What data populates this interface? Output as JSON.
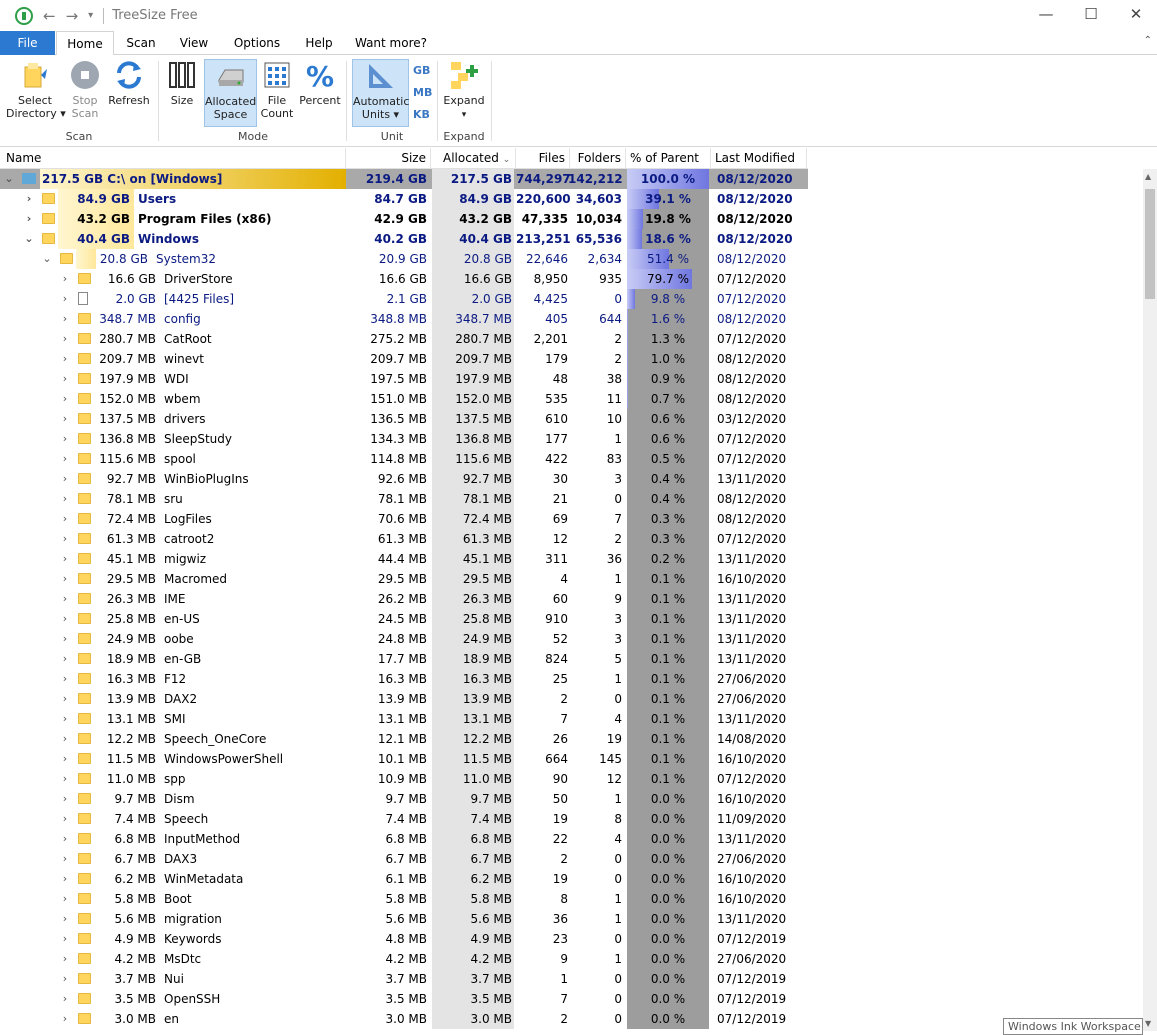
{
  "app": {
    "title": "TreeSize Free",
    "quick_access": [
      "←",
      "→",
      "▾"
    ]
  },
  "window_controls": {
    "minimize": "—",
    "maximize": "☐",
    "close": "✕"
  },
  "tabs": [
    {
      "label": "File"
    },
    {
      "label": "Home"
    },
    {
      "label": "Scan"
    },
    {
      "label": "View"
    },
    {
      "label": "Options"
    },
    {
      "label": "Help"
    },
    {
      "label": "Want more?"
    }
  ],
  "ribbon": {
    "select_directory": "Select\nDirectory ▾",
    "stop_scan": "Stop\nScan",
    "refresh": "Refresh",
    "size": "Size",
    "allocated_space": "Allocated\nSpace",
    "file_count": "File\nCount",
    "percent": "Percent",
    "automatic_units": "Automatic\nUnits ▾",
    "unit_gb": "GB",
    "unit_mb": "MB",
    "unit_kb": "KB",
    "expand": "Expand",
    "groups": {
      "scan": "Scan",
      "mode": "Mode",
      "unit": "Unit",
      "expand": "Expand"
    }
  },
  "columns": {
    "name": "Name",
    "size": "Size",
    "allocated": "Allocated",
    "files": "Files",
    "folders": "Folders",
    "pct": "% of Parent ...",
    "modified": "Last Modified"
  },
  "rows": [
    {
      "level": 0,
      "label": "217.5 GB  C:\\  on  [Windows]",
      "size": "219.4 GB",
      "alloc": "217.5 GB",
      "files": "744,297",
      "folders": "142,212",
      "pct": "100.0 %",
      "pct_value": 100.0,
      "mod": "08/12/2020",
      "style": "root",
      "exp": "v",
      "icon": "drive"
    },
    {
      "level": 1,
      "sz": "84.9 GB",
      "name": "Users",
      "size": "84.7 GB",
      "alloc": "84.9 GB",
      "files": "220,600",
      "folders": "34,603",
      "pct": "39.1 %",
      "pct_value": 39.1,
      "mod": "08/12/2020",
      "style": "bold-blue",
      "exp": ">"
    },
    {
      "level": 1,
      "sz": "43.2 GB",
      "name": "Program Files (x86)",
      "size": "42.9 GB",
      "alloc": "43.2 GB",
      "files": "47,335",
      "folders": "10,034",
      "pct": "19.8 %",
      "pct_value": 19.8,
      "mod": "08/12/2020",
      "style": "bold",
      "exp": ">"
    },
    {
      "level": 1,
      "sz": "40.4 GB",
      "name": "Windows",
      "size": "40.2 GB",
      "alloc": "40.4 GB",
      "files": "213,251",
      "folders": "65,536",
      "pct": "18.6 %",
      "pct_value": 18.6,
      "mod": "08/12/2020",
      "style": "bold-blue",
      "exp": "v"
    },
    {
      "level": 2,
      "sz": "20.8 GB",
      "name": "System32",
      "size": "20.9 GB",
      "alloc": "20.8 GB",
      "files": "22,646",
      "folders": "2,634",
      "pct": "51.4 %",
      "pct_value": 51.4,
      "mod": "08/12/2020",
      "style": "blue",
      "exp": "v"
    },
    {
      "level": 3,
      "sz": "16.6 GB",
      "name": "DriverStore",
      "size": "16.6 GB",
      "alloc": "16.6 GB",
      "files": "8,950",
      "folders": "935",
      "pct": "79.7 %",
      "pct_value": 79.7,
      "mod": "07/12/2020",
      "style": "",
      "exp": ">"
    },
    {
      "level": 3,
      "sz": "2.0 GB",
      "name": "[4425 Files]",
      "size": "2.1 GB",
      "alloc": "2.0 GB",
      "files": "4,425",
      "folders": "0",
      "pct": "9.8 %",
      "pct_value": 9.8,
      "mod": "07/12/2020",
      "style": "blue",
      "exp": ">",
      "icon": "file"
    },
    {
      "level": 3,
      "sz": "348.7 MB",
      "name": "config",
      "size": "348.8 MB",
      "alloc": "348.7 MB",
      "files": "405",
      "folders": "644",
      "pct": "1.6 %",
      "pct_value": 1.6,
      "mod": "08/12/2020",
      "style": "blue",
      "exp": ">"
    },
    {
      "level": 3,
      "sz": "280.7 MB",
      "name": "CatRoot",
      "size": "275.2 MB",
      "alloc": "280.7 MB",
      "files": "2,201",
      "folders": "2",
      "pct": "1.3 %",
      "pct_value": 1.3,
      "mod": "07/12/2020",
      "style": "",
      "exp": ">"
    },
    {
      "level": 3,
      "sz": "209.7 MB",
      "name": "winevt",
      "size": "209.7 MB",
      "alloc": "209.7 MB",
      "files": "179",
      "folders": "2",
      "pct": "1.0 %",
      "pct_value": 1.0,
      "mod": "08/12/2020",
      "style": "",
      "exp": ">"
    },
    {
      "level": 3,
      "sz": "197.9 MB",
      "name": "WDI",
      "size": "197.5 MB",
      "alloc": "197.9 MB",
      "files": "48",
      "folders": "38",
      "pct": "0.9 %",
      "pct_value": 0.9,
      "mod": "08/12/2020",
      "style": "",
      "exp": ">"
    },
    {
      "level": 3,
      "sz": "152.0 MB",
      "name": "wbem",
      "size": "151.0 MB",
      "alloc": "152.0 MB",
      "files": "535",
      "folders": "11",
      "pct": "0.7 %",
      "pct_value": 0.7,
      "mod": "08/12/2020",
      "style": "",
      "exp": ">"
    },
    {
      "level": 3,
      "sz": "137.5 MB",
      "name": "drivers",
      "size": "136.5 MB",
      "alloc": "137.5 MB",
      "files": "610",
      "folders": "10",
      "pct": "0.6 %",
      "pct_value": 0.6,
      "mod": "03/12/2020",
      "style": "",
      "exp": ">"
    },
    {
      "level": 3,
      "sz": "136.8 MB",
      "name": "SleepStudy",
      "size": "134.3 MB",
      "alloc": "136.8 MB",
      "files": "177",
      "folders": "1",
      "pct": "0.6 %",
      "pct_value": 0.6,
      "mod": "07/12/2020",
      "style": "",
      "exp": ">"
    },
    {
      "level": 3,
      "sz": "115.6 MB",
      "name": "spool",
      "size": "114.8 MB",
      "alloc": "115.6 MB",
      "files": "422",
      "folders": "83",
      "pct": "0.5 %",
      "pct_value": 0.5,
      "mod": "07/12/2020",
      "style": "",
      "exp": ">"
    },
    {
      "level": 3,
      "sz": "92.7 MB",
      "name": "WinBioPlugIns",
      "size": "92.6 MB",
      "alloc": "92.7 MB",
      "files": "30",
      "folders": "3",
      "pct": "0.4 %",
      "pct_value": 0.4,
      "mod": "13/11/2020",
      "style": "",
      "exp": ">"
    },
    {
      "level": 3,
      "sz": "78.1 MB",
      "name": "sru",
      "size": "78.1 MB",
      "alloc": "78.1 MB",
      "files": "21",
      "folders": "0",
      "pct": "0.4 %",
      "pct_value": 0.4,
      "mod": "08/12/2020",
      "style": "",
      "exp": ">"
    },
    {
      "level": 3,
      "sz": "72.4 MB",
      "name": "LogFiles",
      "size": "70.6 MB",
      "alloc": "72.4 MB",
      "files": "69",
      "folders": "7",
      "pct": "0.3 %",
      "pct_value": 0.3,
      "mod": "08/12/2020",
      "style": "",
      "exp": ">"
    },
    {
      "level": 3,
      "sz": "61.3 MB",
      "name": "catroot2",
      "size": "61.3 MB",
      "alloc": "61.3 MB",
      "files": "12",
      "folders": "2",
      "pct": "0.3 %",
      "pct_value": 0.3,
      "mod": "07/12/2020",
      "style": "",
      "exp": ">"
    },
    {
      "level": 3,
      "sz": "45.1 MB",
      "name": "migwiz",
      "size": "44.4 MB",
      "alloc": "45.1 MB",
      "files": "311",
      "folders": "36",
      "pct": "0.2 %",
      "pct_value": 0.2,
      "mod": "13/11/2020",
      "style": "",
      "exp": ">"
    },
    {
      "level": 3,
      "sz": "29.5 MB",
      "name": "Macromed",
      "size": "29.5 MB",
      "alloc": "29.5 MB",
      "files": "4",
      "folders": "1",
      "pct": "0.1 %",
      "pct_value": 0.1,
      "mod": "16/10/2020",
      "style": "",
      "exp": ">"
    },
    {
      "level": 3,
      "sz": "26.3 MB",
      "name": "IME",
      "size": "26.2 MB",
      "alloc": "26.3 MB",
      "files": "60",
      "folders": "9",
      "pct": "0.1 %",
      "pct_value": 0.1,
      "mod": "13/11/2020",
      "style": "",
      "exp": ">"
    },
    {
      "level": 3,
      "sz": "25.8 MB",
      "name": "en-US",
      "size": "24.5 MB",
      "alloc": "25.8 MB",
      "files": "910",
      "folders": "3",
      "pct": "0.1 %",
      "pct_value": 0.1,
      "mod": "13/11/2020",
      "style": "",
      "exp": ">"
    },
    {
      "level": 3,
      "sz": "24.9 MB",
      "name": "oobe",
      "size": "24.8 MB",
      "alloc": "24.9 MB",
      "files": "52",
      "folders": "3",
      "pct": "0.1 %",
      "pct_value": 0.1,
      "mod": "13/11/2020",
      "style": "",
      "exp": ">"
    },
    {
      "level": 3,
      "sz": "18.9 MB",
      "name": "en-GB",
      "size": "17.7 MB",
      "alloc": "18.9 MB",
      "files": "824",
      "folders": "5",
      "pct": "0.1 %",
      "pct_value": 0.1,
      "mod": "13/11/2020",
      "style": "",
      "exp": ">"
    },
    {
      "level": 3,
      "sz": "16.3 MB",
      "name": "F12",
      "size": "16.3 MB",
      "alloc": "16.3 MB",
      "files": "25",
      "folders": "1",
      "pct": "0.1 %",
      "pct_value": 0.1,
      "mod": "27/06/2020",
      "style": "",
      "exp": ">"
    },
    {
      "level": 3,
      "sz": "13.9 MB",
      "name": "DAX2",
      "size": "13.9 MB",
      "alloc": "13.9 MB",
      "files": "2",
      "folders": "0",
      "pct": "0.1 %",
      "pct_value": 0.1,
      "mod": "27/06/2020",
      "style": "",
      "exp": ">"
    },
    {
      "level": 3,
      "sz": "13.1 MB",
      "name": "SMI",
      "size": "13.1 MB",
      "alloc": "13.1 MB",
      "files": "7",
      "folders": "4",
      "pct": "0.1 %",
      "pct_value": 0.1,
      "mod": "13/11/2020",
      "style": "",
      "exp": ">"
    },
    {
      "level": 3,
      "sz": "12.2 MB",
      "name": "Speech_OneCore",
      "size": "12.1 MB",
      "alloc": "12.2 MB",
      "files": "26",
      "folders": "19",
      "pct": "0.1 %",
      "pct_value": 0.1,
      "mod": "14/08/2020",
      "style": "",
      "exp": ">"
    },
    {
      "level": 3,
      "sz": "11.5 MB",
      "name": "WindowsPowerShell",
      "size": "10.1 MB",
      "alloc": "11.5 MB",
      "files": "664",
      "folders": "145",
      "pct": "0.1 %",
      "pct_value": 0.1,
      "mod": "16/10/2020",
      "style": "",
      "exp": ">"
    },
    {
      "level": 3,
      "sz": "11.0 MB",
      "name": "spp",
      "size": "10.9 MB",
      "alloc": "11.0 MB",
      "files": "90",
      "folders": "12",
      "pct": "0.1 %",
      "pct_value": 0.1,
      "mod": "07/12/2020",
      "style": "",
      "exp": ">"
    },
    {
      "level": 3,
      "sz": "9.7 MB",
      "name": "Dism",
      "size": "9.7 MB",
      "alloc": "9.7 MB",
      "files": "50",
      "folders": "1",
      "pct": "0.0 %",
      "pct_value": 0.0,
      "mod": "16/10/2020",
      "style": "",
      "exp": ">"
    },
    {
      "level": 3,
      "sz": "7.4 MB",
      "name": "Speech",
      "size": "7.4 MB",
      "alloc": "7.4 MB",
      "files": "19",
      "folders": "8",
      "pct": "0.0 %",
      "pct_value": 0.0,
      "mod": "11/09/2020",
      "style": "",
      "exp": ">"
    },
    {
      "level": 3,
      "sz": "6.8 MB",
      "name": "InputMethod",
      "size": "6.8 MB",
      "alloc": "6.8 MB",
      "files": "22",
      "folders": "4",
      "pct": "0.0 %",
      "pct_value": 0.0,
      "mod": "13/11/2020",
      "style": "",
      "exp": ">"
    },
    {
      "level": 3,
      "sz": "6.7 MB",
      "name": "DAX3",
      "size": "6.7 MB",
      "alloc": "6.7 MB",
      "files": "2",
      "folders": "0",
      "pct": "0.0 %",
      "pct_value": 0.0,
      "mod": "27/06/2020",
      "style": "",
      "exp": ">"
    },
    {
      "level": 3,
      "sz": "6.2 MB",
      "name": "WinMetadata",
      "size": "6.1 MB",
      "alloc": "6.2 MB",
      "files": "19",
      "folders": "0",
      "pct": "0.0 %",
      "pct_value": 0.0,
      "mod": "16/10/2020",
      "style": "",
      "exp": ">"
    },
    {
      "level": 3,
      "sz": "5.8 MB",
      "name": "Boot",
      "size": "5.8 MB",
      "alloc": "5.8 MB",
      "files": "8",
      "folders": "1",
      "pct": "0.0 %",
      "pct_value": 0.0,
      "mod": "16/10/2020",
      "style": "",
      "exp": ">"
    },
    {
      "level": 3,
      "sz": "5.6 MB",
      "name": "migration",
      "size": "5.6 MB",
      "alloc": "5.6 MB",
      "files": "36",
      "folders": "1",
      "pct": "0.0 %",
      "pct_value": 0.0,
      "mod": "13/11/2020",
      "style": "",
      "exp": ">"
    },
    {
      "level": 3,
      "sz": "4.9 MB",
      "name": "Keywords",
      "size": "4.8 MB",
      "alloc": "4.9 MB",
      "files": "23",
      "folders": "0",
      "pct": "0.0 %",
      "pct_value": 0.0,
      "mod": "07/12/2019",
      "style": "",
      "exp": ">"
    },
    {
      "level": 3,
      "sz": "4.2 MB",
      "name": "MsDtc",
      "size": "4.2 MB",
      "alloc": "4.2 MB",
      "files": "9",
      "folders": "1",
      "pct": "0.0 %",
      "pct_value": 0.0,
      "mod": "27/06/2020",
      "style": "",
      "exp": ">"
    },
    {
      "level": 3,
      "sz": "3.7 MB",
      "name": "Nui",
      "size": "3.7 MB",
      "alloc": "3.7 MB",
      "files": "1",
      "folders": "0",
      "pct": "0.0 %",
      "pct_value": 0.0,
      "mod": "07/12/2019",
      "style": "",
      "exp": ">"
    },
    {
      "level": 3,
      "sz": "3.5 MB",
      "name": "OpenSSH",
      "size": "3.5 MB",
      "alloc": "3.5 MB",
      "files": "7",
      "folders": "0",
      "pct": "0.0 %",
      "pct_value": 0.0,
      "mod": "07/12/2019",
      "style": "",
      "exp": ">"
    },
    {
      "level": 3,
      "sz": "3.0 MB",
      "name": "en",
      "size": "3.0 MB",
      "alloc": "3.0 MB",
      "files": "2",
      "folders": "0",
      "pct": "0.0 %",
      "pct_value": 0.0,
      "mod": "07/12/2019",
      "style": "",
      "exp": ">"
    }
  ],
  "overlay": {
    "ink_workspace": "Windows Ink Workspace"
  },
  "colors": {
    "accent": "#2b79d0",
    "pct_bar": "#6f76e0",
    "folder": "#ffd55e",
    "blue_text": "#0b1a82"
  },
  "icons": [
    "app-icon",
    "back-arrow-icon",
    "forward-arrow-icon",
    "folder-select-icon",
    "stop-icon",
    "refresh-icon",
    "size-icon",
    "hard-disk-icon",
    "grid-icon",
    "percent-icon",
    "units-icon",
    "expand-icon",
    "folder-icon",
    "file-icon",
    "drive-icon"
  ]
}
